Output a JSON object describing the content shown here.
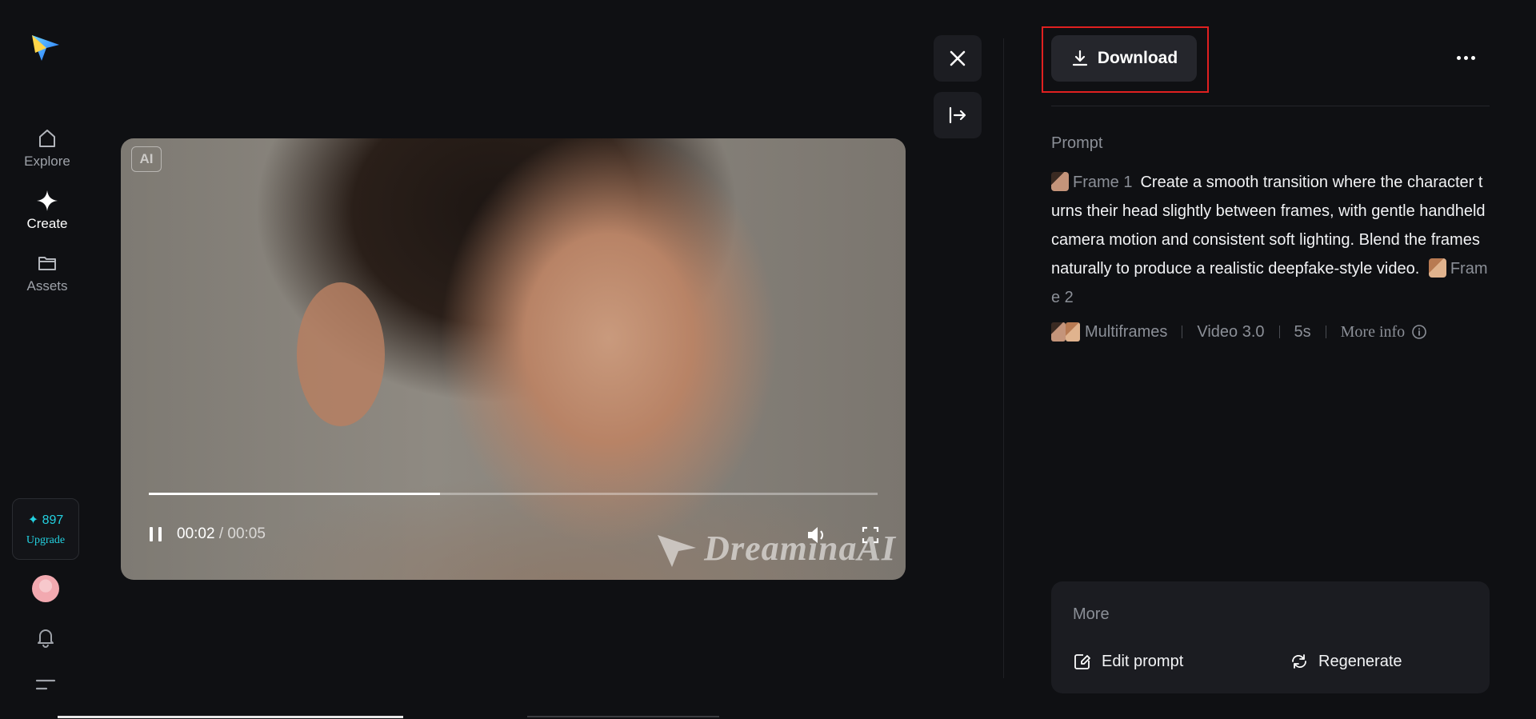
{
  "sidebar": {
    "items": [
      {
        "label": "Explore",
        "icon": "home-icon",
        "active": false
      },
      {
        "label": "Create",
        "icon": "sparkle-icon",
        "active": true
      },
      {
        "label": "Assets",
        "icon": "folder-icon",
        "active": false
      }
    ],
    "credits": "897",
    "upgrade_label": "Upgrade"
  },
  "video": {
    "ai_badge": "AI",
    "watermark": "DreaminaAI",
    "current_time": "00:02",
    "separator": " / ",
    "duration": "00:05",
    "progress": 0.4
  },
  "panel": {
    "download_label": "Download",
    "prompt_heading": "Prompt",
    "frame1_label": "Frame 1",
    "prompt_text": "Create a smooth transition where the character turns their head slightly between frames, with gentle handheld camera motion and consistent soft lighting. Blend the frames naturally to produce a realistic deepfake-style video.",
    "frame2_label": "Frame 2",
    "meta": {
      "mode": "Multiframes",
      "model": "Video 3.0",
      "length": "5s",
      "more_info": "More info"
    },
    "more_card": {
      "title": "More",
      "edit_prompt": "Edit prompt",
      "regenerate": "Regenerate"
    }
  },
  "colors": {
    "background": "#0f1013",
    "accent": "#23d1e0",
    "highlight": "#e02020"
  }
}
